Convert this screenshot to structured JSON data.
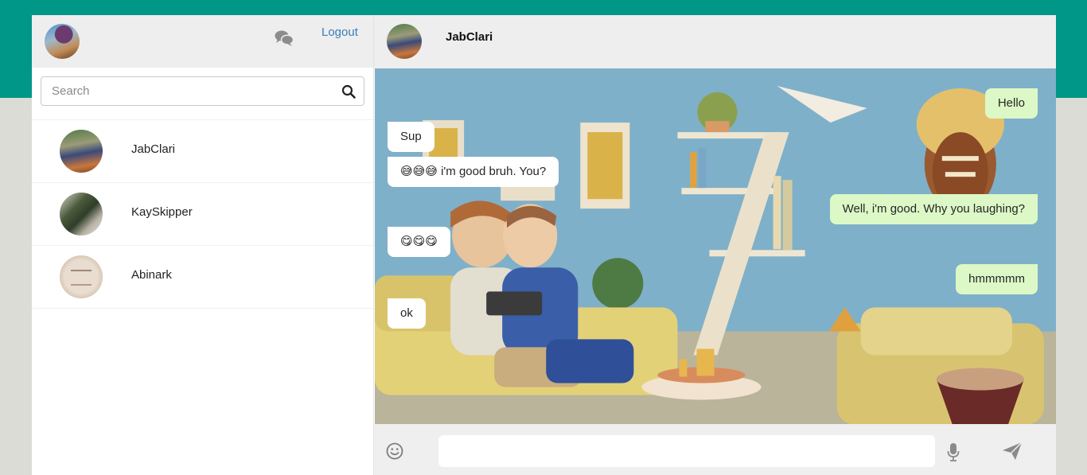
{
  "sidebar": {
    "logout_label": "Logout",
    "search_placeholder": "Search",
    "contacts": [
      {
        "name": "JabClari"
      },
      {
        "name": "KaySkipper"
      },
      {
        "name": "Abinark"
      }
    ]
  },
  "chat": {
    "contact_name": "JabClari",
    "messages": [
      {
        "direction": "out",
        "text": "Hello"
      },
      {
        "direction": "in",
        "text": "Sup"
      },
      {
        "direction": "in",
        "text": "😅😅😅 i'm good bruh. You?"
      },
      {
        "direction": "out",
        "text": "Well, i'm good. Why you laughing?"
      },
      {
        "direction": "in",
        "text": "😋😋😋"
      },
      {
        "direction": "out",
        "text": "hmmmmm"
      },
      {
        "direction": "in",
        "text": "ok"
      }
    ],
    "composer_value": ""
  },
  "colors": {
    "header_band": "#009688",
    "outgoing_bubble": "#dcf8c6",
    "incoming_bubble": "#ffffff",
    "link": "#3b7dbd"
  },
  "icons": [
    "chat-bubbles-icon",
    "search-icon",
    "smiley-icon",
    "microphone-icon",
    "send-icon"
  ]
}
